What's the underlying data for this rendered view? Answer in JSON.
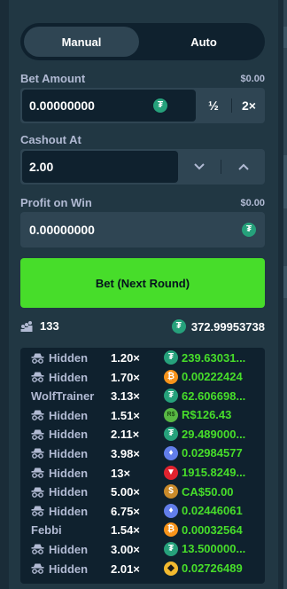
{
  "mode_tabs": [
    {
      "label": "Manual",
      "active": true
    },
    {
      "label": "Auto",
      "active": false
    }
  ],
  "bet_amount": {
    "label": "Bet Amount",
    "usd_value": "$0.00",
    "value": "0.00000000",
    "currency_icon": "tether-icon",
    "half_label": "½",
    "double_label": "2×"
  },
  "cashout": {
    "label": "Cashout At",
    "value": "2.00",
    "down_icon": "chevron-down-icon",
    "up_icon": "chevron-up-icon"
  },
  "profit_on_win": {
    "label": "Profit on Win",
    "usd_value": "$0.00",
    "value": "0.00000000",
    "currency_icon": "tether-icon"
  },
  "bet_button": {
    "label": "Bet (Next Round)",
    "color": "#47dd2a"
  },
  "stats": {
    "players_icon": "players-icon",
    "player_count": "133",
    "total_icon": "tether-icon",
    "total_amount": "372.99953738"
  },
  "bets": [
    {
      "player": "Hidden",
      "hidden": true,
      "multiplier": "1.20×",
      "currency": "tether",
      "profit": "239.63031..."
    },
    {
      "player": "Hidden",
      "hidden": true,
      "multiplier": "1.70×",
      "currency": "btc",
      "profit": "0.00222424"
    },
    {
      "player": "WolfTrainer",
      "hidden": false,
      "multiplier": "3.13×",
      "currency": "tether",
      "profit": "62.606698..."
    },
    {
      "player": "Hidden",
      "hidden": true,
      "multiplier": "1.51×",
      "currency": "brl",
      "profit": "R$126.43"
    },
    {
      "player": "Hidden",
      "hidden": true,
      "multiplier": "2.11×",
      "currency": "tether",
      "profit": "29.489000..."
    },
    {
      "player": "Hidden",
      "hidden": true,
      "multiplier": "3.98×",
      "currency": "eth",
      "profit": "0.02984577"
    },
    {
      "player": "Hidden",
      "hidden": true,
      "multiplier": "13×",
      "currency": "trx",
      "profit": "1915.8249..."
    },
    {
      "player": "Hidden",
      "hidden": true,
      "multiplier": "5.00×",
      "currency": "cad",
      "profit": "CA$50.00"
    },
    {
      "player": "Hidden",
      "hidden": true,
      "multiplier": "6.75×",
      "currency": "eth",
      "profit": "0.02446061"
    },
    {
      "player": "Febbi",
      "hidden": false,
      "multiplier": "1.54×",
      "currency": "btc",
      "profit": "0.00032564"
    },
    {
      "player": "Hidden",
      "hidden": true,
      "multiplier": "3.00×",
      "currency": "tether",
      "profit": "13.500000..."
    },
    {
      "player": "Hidden",
      "hidden": true,
      "multiplier": "2.01×",
      "currency": "bnb",
      "profit": "0.02726489"
    }
  ],
  "colors": {
    "background": "#1a2c38",
    "panel": "#213743",
    "input": "#0f212e",
    "accent_green": "#47dd2a",
    "label_gray": "#b1bad3"
  }
}
